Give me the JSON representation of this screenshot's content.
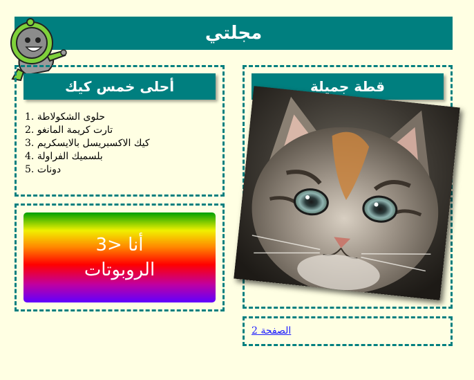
{
  "header": {
    "title": "مجلتي"
  },
  "cakes_panel": {
    "heading": "أحلى خمس كيك",
    "items": [
      "1. حلوى الشكولاطة",
      "2. تارت كريمة المانغو",
      "3. كيك الاكسبريسل بالايسكريم",
      "4. بلسميك الفراولة",
      "5. دونات"
    ]
  },
  "robots_panel": {
    "line1": "أنا <3",
    "line2": "الروبوتات"
  },
  "cat_panel": {
    "heading": "قطة جميلة"
  },
  "pagination": {
    "link_label": "الصفحة 2"
  },
  "colors": {
    "accent": "#007f7f",
    "background": "#ffffe3",
    "link": "#1a1aff"
  },
  "icons": {
    "mascot": "robot-mascot-icon"
  }
}
